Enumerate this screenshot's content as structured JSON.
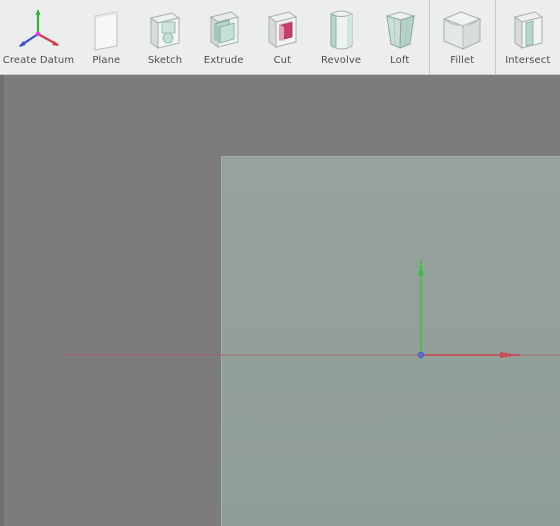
{
  "toolbar": {
    "create_datum": "Create Datum",
    "plane": "Plane",
    "sketch": "Sketch",
    "extrude": "Extrude",
    "cut": "Cut",
    "revolve": "Revolve",
    "loft": "Loft",
    "fillet": "Fillet",
    "intersect": "Intersect"
  },
  "icons": {
    "create_datum": "datum-axes-icon",
    "plane": "plane-icon",
    "sketch": "sketch-icon",
    "extrude": "extrude-icon",
    "cut": "cut-icon",
    "revolve": "revolve-icon",
    "loft": "loft-icon",
    "fillet": "fillet-icon",
    "intersect": "intersect-icon"
  },
  "colors": {
    "toolbar_bg": "#eceeee",
    "viewport_bg": "#7b7c7b",
    "plane": "#94a19b",
    "x_axis": "#c8454f",
    "y_axis": "#3dbd3d",
    "z_axis": "#4a56d8"
  }
}
